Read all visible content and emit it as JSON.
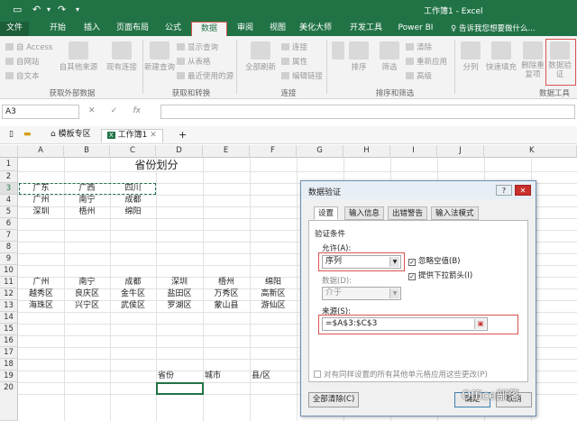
{
  "app": {
    "title": "工作簿1 - Excel",
    "qa_icons": [
      "save-icon",
      "undo-icon",
      "redo-icon",
      "customize-icon"
    ]
  },
  "tabs": [
    {
      "label": "文件"
    },
    {
      "label": "开始"
    },
    {
      "label": "插入"
    },
    {
      "label": "页面布局"
    },
    {
      "label": "公式"
    },
    {
      "label": "数据",
      "active": true
    },
    {
      "label": "审阅"
    },
    {
      "label": "视图"
    },
    {
      "label": "美化大师"
    },
    {
      "label": "开发工具"
    },
    {
      "label": "Power BI"
    }
  ],
  "tell_me": "告诉我您想要做什么...",
  "ribbon": {
    "get_external": {
      "access": "自 Access",
      "web": "自网站",
      "text": "自文本",
      "other": "自其他来源",
      "existing": "现有连接",
      "group": "获取外部数据"
    },
    "get_transform": {
      "new_query": "新建查询",
      "show_queries": "显示查询",
      "from_table": "从表格",
      "recent": "最近使用的源",
      "group": "获取和转换"
    },
    "connections": {
      "refresh": "全部刷新",
      "conn": "连接",
      "props": "属性",
      "edit_links": "编辑链接",
      "group": "连接"
    },
    "sort_filter": {
      "sort": "排序",
      "filter": "筛选",
      "clear": "清除",
      "reapply": "重新应用",
      "advanced": "高级",
      "group": "排序和筛选"
    },
    "data_tools": {
      "split": "分列",
      "flash": "快速填充",
      "remove_dup": "删除重复项",
      "validation": "数据验证",
      "group": "数据工具"
    }
  },
  "formula_bar": {
    "name_box": "A3",
    "cancel": "✕",
    "enter": "✓",
    "fx": "fx"
  },
  "workbook_tabs": [
    {
      "label": "稻壳儿",
      "icon": "home-icon"
    },
    {
      "label": "模板专区"
    },
    {
      "label": "工作簿1",
      "icon": "excel-icon"
    },
    {
      "label": "+"
    }
  ],
  "grid": {
    "columns": [
      "A",
      "B",
      "C",
      "D",
      "E",
      "F",
      "G",
      "H",
      "I",
      "J",
      "K"
    ],
    "rows": [
      "1",
      "2",
      "3",
      "4",
      "5",
      "6",
      "7",
      "8",
      "9",
      "10",
      "11",
      "12",
      "13",
      "14",
      "15",
      "16",
      "17",
      "18",
      "19",
      "20"
    ],
    "title": "省份划分",
    "provinces": [
      "广东",
      "广西",
      "四川"
    ],
    "row4": [
      "广州",
      "南宁",
      "成都"
    ],
    "row5": [
      "深圳",
      "梧州",
      "绵阳"
    ],
    "row10": [
      "广州",
      "南宁",
      "成都",
      "深圳",
      "梧州",
      "绵阳"
    ],
    "row11": [
      "越秀区",
      "良庆区",
      "金牛区",
      "盐田区",
      "万秀区",
      "高新区"
    ],
    "row12": [
      "海珠区",
      "兴宁区",
      "武侯区",
      "罗湖区",
      "蒙山县",
      "游仙区"
    ],
    "row18": [
      "省份",
      "城市",
      "县/区"
    ]
  },
  "dialog": {
    "title": "数据验证",
    "help": "?",
    "close": "✕",
    "tabs": [
      "设置",
      "输入信息",
      "出错警告",
      "输入法模式"
    ],
    "criteria": "验证条件",
    "allow_label": "允许(A):",
    "allow_value": "序列",
    "ignore_blank": "忽略空值(B)",
    "dropdown": "提供下拉箭头(I)",
    "data_label": "数据(D):",
    "data_value": "介于",
    "source_label": "来源(S):",
    "source_value": "=$A$3:$C$3",
    "apply_all": "对有同样设置的所有其他单元格应用这些更改(P)",
    "clear_all": "全部清除(C)",
    "ok": "确定",
    "cancel": "取消"
  },
  "watermark": "Office部落",
  "colors": {
    "excel_green": "#217346",
    "highlight_red": "#d9534f",
    "selection_green": "#217346"
  }
}
